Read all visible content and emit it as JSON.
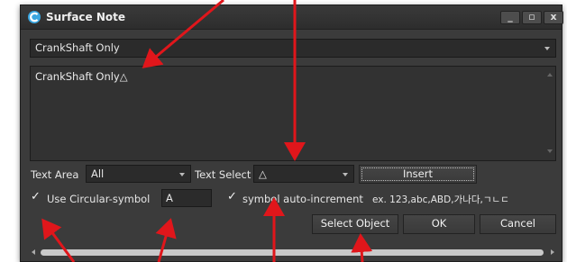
{
  "window": {
    "title": "Surface Note",
    "min_glyph": "_",
    "max_glyph": "▫",
    "close_glyph": "x"
  },
  "top_combo": {
    "value": "CrankShaft Only"
  },
  "note": {
    "text": "CrankShaft Only△"
  },
  "text_area": {
    "label": "Text Area",
    "value": "All"
  },
  "text_select": {
    "label": "Text Select",
    "value": "△"
  },
  "insert_button": "Insert",
  "use_circular": {
    "check": "✓",
    "label": "Use Circular-symbol",
    "value": "A"
  },
  "auto_increment": {
    "check": "✓",
    "label": "symbol auto-increment",
    "example": "ex. 123,abc,ABD,가나다,ㄱㄴㄷ"
  },
  "buttons": {
    "select_object": "Select Object",
    "ok": "OK",
    "cancel": "Cancel"
  },
  "colors": {
    "dialog_bg": "#3b3b3b",
    "annotation_arrow": "#e0161b",
    "app_icon": "#3aa6e0"
  },
  "icons": {
    "app": "surface-note-app-icon"
  }
}
